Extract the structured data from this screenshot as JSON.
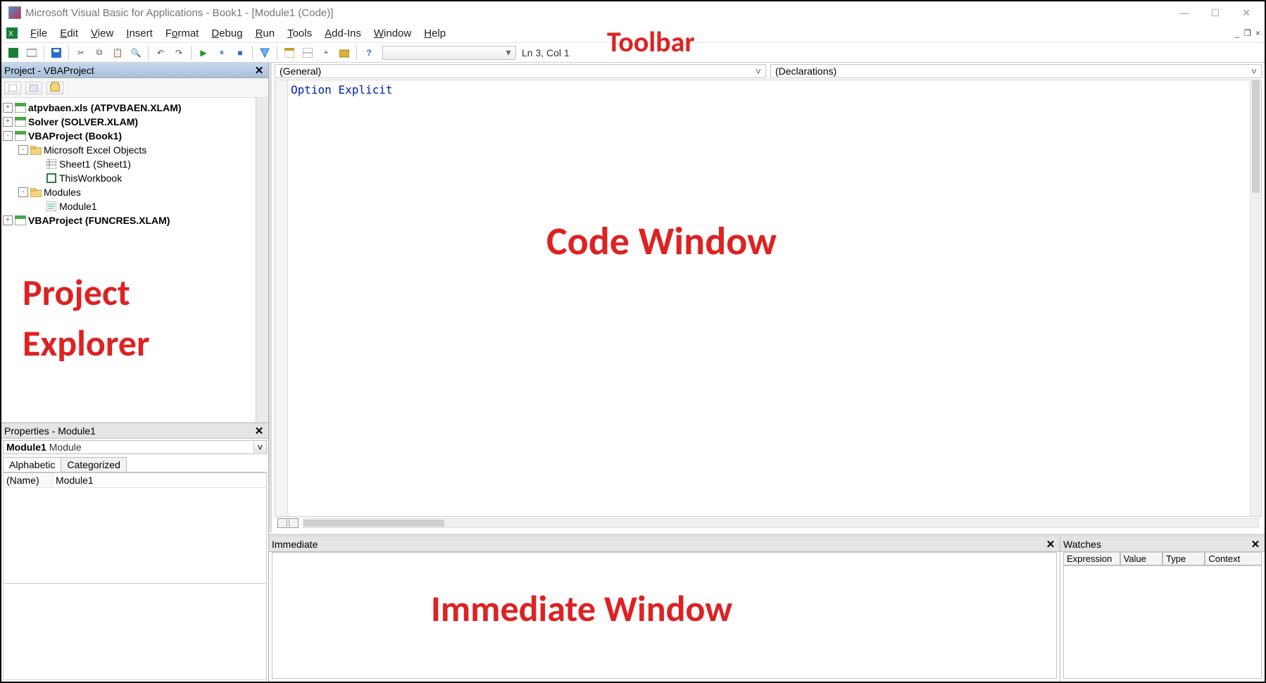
{
  "window": {
    "title": "Microsoft Visual Basic for Applications - Book1 - [Module1 (Code)]"
  },
  "menu": {
    "items": [
      "File",
      "Edit",
      "View",
      "Insert",
      "Format",
      "Debug",
      "Run",
      "Tools",
      "Add-Ins",
      "Window",
      "Help"
    ]
  },
  "toolbar": {
    "status": "Ln 3, Col 1"
  },
  "annotations": {
    "toolbar": "Toolbar",
    "project_explorer_1": "Project",
    "project_explorer_2": "Explorer",
    "code_window": "Code Window",
    "immediate_window": "Immediate Window"
  },
  "project_explorer": {
    "title": "Project - VBAProject",
    "nodes": [
      {
        "label": "atpvbaen.xls (ATPVBAEN.XLAM)",
        "bold": true,
        "icon": "proj",
        "depth": 0,
        "tw": "+"
      },
      {
        "label": "Solver (SOLVER.XLAM)",
        "bold": true,
        "icon": "proj",
        "depth": 0,
        "tw": "+"
      },
      {
        "label": "VBAProject (Book1)",
        "bold": true,
        "icon": "proj",
        "depth": 0,
        "tw": "-"
      },
      {
        "label": "Microsoft Excel Objects",
        "icon": "folder",
        "depth": 1,
        "tw": "-"
      },
      {
        "label": "Sheet1 (Sheet1)",
        "icon": "sheet",
        "depth": 2,
        "tw": ""
      },
      {
        "label": "ThisWorkbook",
        "icon": "wb",
        "depth": 2,
        "tw": ""
      },
      {
        "label": "Modules",
        "icon": "folder",
        "depth": 1,
        "tw": "-"
      },
      {
        "label": "Module1",
        "icon": "mod",
        "depth": 2,
        "tw": ""
      },
      {
        "label": "VBAProject (FUNCRES.XLAM)",
        "bold": true,
        "icon": "proj",
        "depth": 0,
        "tw": "+"
      }
    ]
  },
  "properties": {
    "title": "Properties - Module1",
    "object_name": "Module1",
    "object_type": "Module",
    "tabs": [
      "Alphabetic",
      "Categorized"
    ],
    "rows": [
      {
        "k": "(Name)",
        "v": "Module1"
      }
    ]
  },
  "code": {
    "left_combo": "(General)",
    "right_combo": "(Declarations)",
    "text": "Option Explicit"
  },
  "immediate": {
    "title": "Immediate"
  },
  "watches": {
    "title": "Watches",
    "cols": [
      "Expression",
      "Value",
      "Type",
      "Context"
    ]
  }
}
